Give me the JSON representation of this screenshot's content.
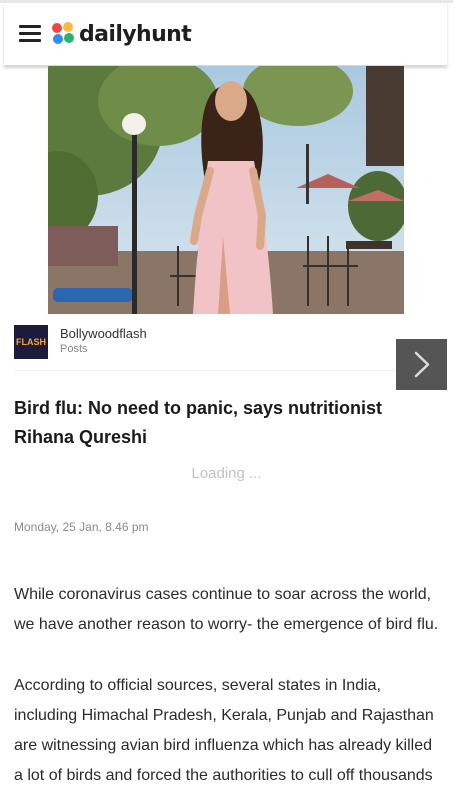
{
  "header": {
    "menu_icon": "hamburger-menu-icon",
    "logo_icon": "dailyhunt-flower-icon",
    "logo_text": "dailyhunt",
    "logo_colors": [
      "#f2453d",
      "#fbb93b",
      "#2f8ef0",
      "#27b56b"
    ]
  },
  "article": {
    "hero_image": "woman-in-pink-dress-outdoor-cafe",
    "source": {
      "logo_text": "FLASH",
      "name": "Bollywoodflash",
      "type": "Posts"
    },
    "next_icon": "chevron-right-icon",
    "headline": "Bird flu: No need to panic, says nutritionist Rihana Qureshi",
    "loading_text": "Loading ...",
    "date": "Monday, 25 Jan, 8.46 pm",
    "paragraphs": [
      "While coronavirus cases continue to soar across the world, we have another reason to worry- the emergence of bird flu.",
      "According to official sources, several states in India, including Himachal Pradesh, Kerala, Punjab and Rajasthan are witnessing avian bird influenza which has already killed a lot of birds and forced the authorities to cull off thousands"
    ]
  }
}
